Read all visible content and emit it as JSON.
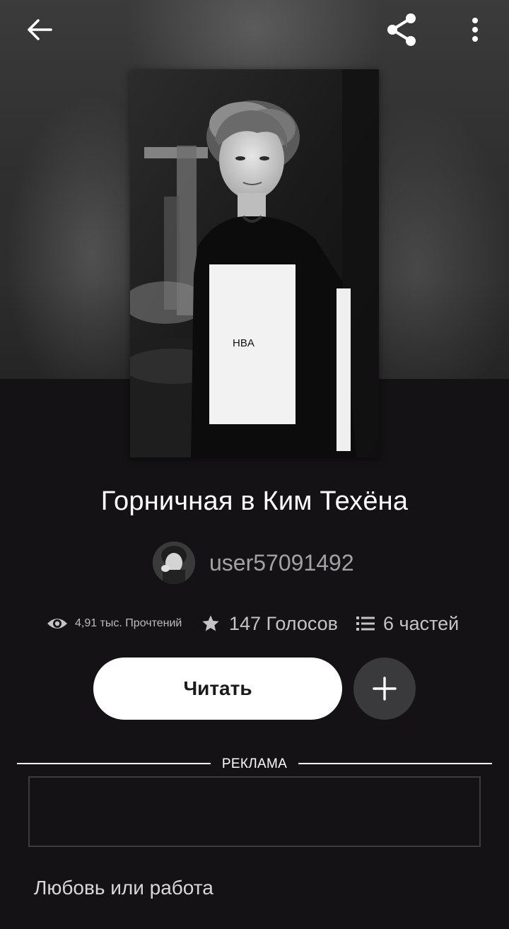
{
  "book": {
    "title": "Горничная в Ким Техёна",
    "author": "user57091492",
    "cover_print": "HBA"
  },
  "stats": {
    "reads": "4,91 тыс. Прочтений",
    "votes": "147 Голосов",
    "parts": "6 частей"
  },
  "actions": {
    "read_label": "Читать"
  },
  "ad": {
    "label": "РЕКЛАМА"
  },
  "description": {
    "first_line": "Любовь или работа"
  },
  "icons": {
    "back": "arrow-left-icon",
    "share": "share-icon",
    "more": "more-vertical-icon",
    "reads": "eye-icon",
    "votes": "star-icon",
    "parts": "list-icon",
    "add": "plus-icon"
  },
  "colors": {
    "background": "#141214",
    "read_button": "#ffffff",
    "add_button": "#3a3a3c",
    "author_text": "#a2a2a2"
  }
}
